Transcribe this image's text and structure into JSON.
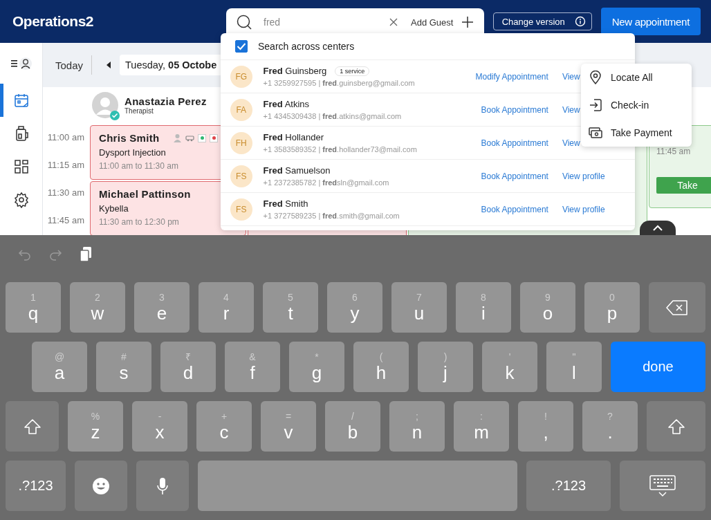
{
  "header": {
    "title": "Operations2",
    "change_version": "Change version",
    "new_appointment": "New appointment"
  },
  "sidebar": [
    {
      "kind": "calendar",
      "selected": true
    },
    {
      "kind": "bottle",
      "selected": false
    },
    {
      "kind": "grid",
      "selected": false
    },
    {
      "kind": "settings",
      "selected": false
    }
  ],
  "calendar": {
    "today": "Today",
    "date": "Tuesday, **05 Octobe**",
    "staff": {
      "name": "Anastazia Perez",
      "role": "Therapist",
      "verified": true
    },
    "times": [
      "11:00 am",
      "11:15 am",
      "11:30 am",
      "11:45 am"
    ],
    "columns": [
      {
        "appointments": [
          {
            "kind": "pending",
            "client": "Chris Smith",
            "service": "Dysport Injection",
            "time": "11:00 am to 11:30 am",
            "indicators": [
              {
                "color": "#2eb872"
              },
              {
                "color": "#e0454a"
              }
            ]
          },
          {
            "kind": "pending",
            "client": "Michael Pattinson",
            "service": "Kybella",
            "time": "11:30 am to 12:30 pm"
          }
        ]
      },
      {
        "appointments": [
          {
            "kind": "pending"
          }
        ]
      },
      {
        "appointments": [
          {
            "kind": "confirmed"
          }
        ]
      },
      {
        "appointments": [
          {
            "kind": "confirmed",
            "time": "11:45 am",
            "button": "Take"
          }
        ]
      }
    ]
  },
  "search": {
    "value": "fred",
    "add_guest": "Add Guest",
    "across": {
      "label": "Search across centers",
      "checked": true
    },
    "results": [
      {
        "initials": "FG",
        "name": "**Fred** Guinsberg",
        "badge": "1 service",
        "contact": "+1 3259927595 | **fred**.guinsberg@gmail.com",
        "action": "Modify Appointment",
        "profile": "View"
      },
      {
        "initials": "FA",
        "name": "**Fred** Atkins",
        "contact": "+1 4345309438 | **fred**.atkins@gmail.com",
        "action": "Book Appointment",
        "profile": "View"
      },
      {
        "initials": "FH",
        "name": "**Fred** Hollander",
        "contact": "+1 3583589352 | **fred**.hollander73@mail.com",
        "action": "Book Appointment",
        "profile": "View"
      },
      {
        "initials": "FS",
        "name": "**Fred** Samuelson",
        "contact": "+1 2372385782 | **fred**sln@gmail.com",
        "action": "Book Appointment",
        "profile": "View profile"
      },
      {
        "initials": "FS",
        "name": "**Fred** Smith",
        "contact": "+1 3727589235 | **fred**.smith@gmail.com",
        "action": "Book Appointment",
        "profile": "View profile"
      }
    ]
  },
  "menu": [
    {
      "kind": "locate",
      "label": "Locate All"
    },
    {
      "kind": "checkin",
      "label": "Check-in"
    },
    {
      "kind": "payment",
      "label": "Take Payment"
    }
  ],
  "keyboard": {
    "rows": [
      [
        {
          "kind": "letter",
          "hint": "1",
          "label": "q"
        },
        {
          "kind": "letter",
          "hint": "2",
          "label": "w"
        },
        {
          "kind": "letter",
          "hint": "3",
          "label": "e"
        },
        {
          "kind": "letter",
          "hint": "4",
          "label": "r"
        },
        {
          "kind": "letter",
          "hint": "5",
          "label": "t"
        },
        {
          "kind": "letter",
          "hint": "6",
          "label": "y"
        },
        {
          "kind": "letter",
          "hint": "7",
          "label": "u"
        },
        {
          "kind": "letter",
          "hint": "8",
          "label": "i"
        },
        {
          "kind": "letter",
          "hint": "9",
          "label": "o"
        },
        {
          "kind": "letter",
          "hint": "0",
          "label": "p"
        },
        {
          "kind": "backspace"
        }
      ],
      [
        {
          "kind": "letter",
          "hint": "@",
          "label": "a"
        },
        {
          "kind": "letter",
          "hint": "#",
          "label": "s"
        },
        {
          "kind": "letter",
          "hint": "₹",
          "label": "d"
        },
        {
          "kind": "letter",
          "hint": "&",
          "label": "f"
        },
        {
          "kind": "letter",
          "hint": "*",
          "label": "g"
        },
        {
          "kind": "letter",
          "hint": "(",
          "label": "h"
        },
        {
          "kind": "letter",
          "hint": ")",
          "label": "j"
        },
        {
          "kind": "letter",
          "hint": "'",
          "label": "k"
        },
        {
          "kind": "letter",
          "hint": "\"",
          "label": "l"
        },
        {
          "kind": "done",
          "label": "done"
        }
      ],
      [
        {
          "kind": "shift"
        },
        {
          "kind": "letter",
          "hint": "%",
          "label": "z"
        },
        {
          "kind": "letter",
          "hint": "-",
          "label": "x"
        },
        {
          "kind": "letter",
          "hint": "+",
          "label": "c"
        },
        {
          "kind": "letter",
          "hint": "=",
          "label": "v"
        },
        {
          "kind": "letter",
          "hint": "/",
          "label": "b"
        },
        {
          "kind": "letter",
          "hint": ";",
          "label": "n"
        },
        {
          "kind": "letter",
          "hint": ":",
          "label": "m"
        },
        {
          "kind": "letter",
          "hint": "!",
          "label": ","
        },
        {
          "kind": "letter",
          "hint": "?",
          "label": "."
        },
        {
          "kind": "shift"
        }
      ],
      [
        {
          "kind": "symbols",
          "label": ".?123"
        },
        {
          "kind": "emoji"
        },
        {
          "kind": "mic"
        },
        {
          "kind": "space"
        },
        {
          "kind": "symbols",
          "label": ".?123"
        },
        {
          "kind": "hide"
        }
      ]
    ]
  }
}
